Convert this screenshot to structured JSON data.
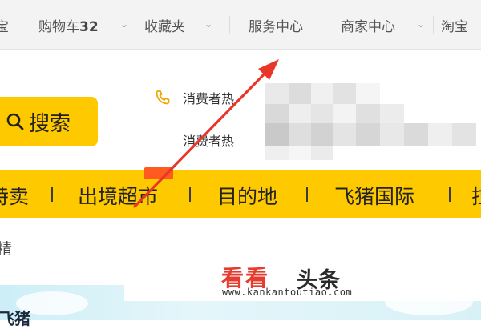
{
  "topnav": {
    "items": [
      {
        "label": "宝"
      },
      {
        "label": "购物车",
        "count": "32"
      },
      {
        "label": "收藏夹"
      },
      {
        "label": "服务中心"
      },
      {
        "label": "商家中心"
      },
      {
        "label": "淘宝"
      }
    ]
  },
  "search": {
    "button_label": "搜索"
  },
  "hotline": {
    "line1_prefix": "消费者热",
    "line2_prefix": "消费者热"
  },
  "categories": [
    "特卖",
    "出境超市",
    "目的地",
    "飞猪国际",
    "拉"
  ],
  "partial_label": "精",
  "banner": {
    "text": "飞猪"
  },
  "watermark": {
    "kan": "看看",
    "tou": "头条",
    "url": "www.kankantoutiao.com"
  },
  "colors": {
    "accent_yellow": "#ffc900",
    "annotation_red": "#e8362b",
    "watermark_red": "#e63c2f"
  },
  "icons": [
    "chevron-down-icon",
    "search-icon",
    "phone-icon",
    "arrow-annotation"
  ]
}
